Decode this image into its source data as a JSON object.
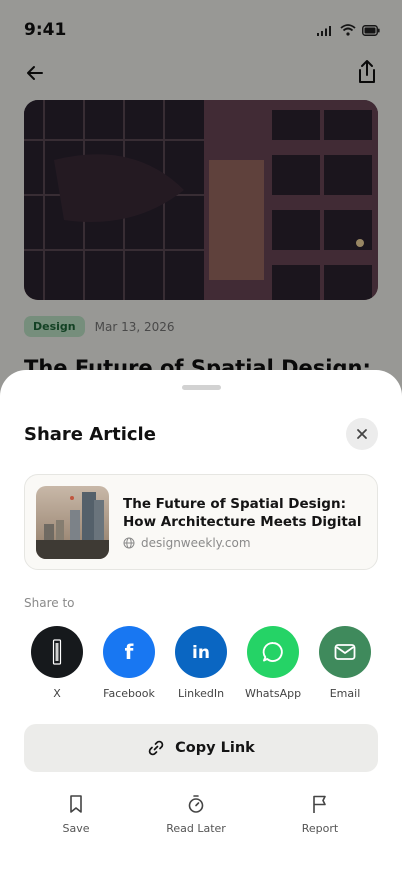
{
  "status_bar": {
    "time": "9:41"
  },
  "article": {
    "tag": "Design",
    "date": "Mar 13, 2026",
    "title": "The Future of Spatial Design: How"
  },
  "sheet": {
    "title": "Share Article",
    "preview": {
      "title": "The Future of Spatial Design: How Architecture Meets Digital",
      "domain": "designweekly.com"
    },
    "share_to_label": "Share to",
    "targets": [
      {
        "label": "X",
        "color": "#16191c"
      },
      {
        "label": "Facebook",
        "color": "#1877f2"
      },
      {
        "label": "LinkedIn",
        "color": "#0a66c2"
      },
      {
        "label": "WhatsApp",
        "color": "#25d366"
      },
      {
        "label": "Email",
        "color": "#3f8a5c"
      }
    ],
    "copy_link_label": "Copy Link",
    "actions": [
      {
        "label": "Save",
        "icon": "bookmark-icon"
      },
      {
        "label": "Read Later",
        "icon": "timer-icon"
      },
      {
        "label": "Report",
        "icon": "flag-icon"
      }
    ]
  }
}
